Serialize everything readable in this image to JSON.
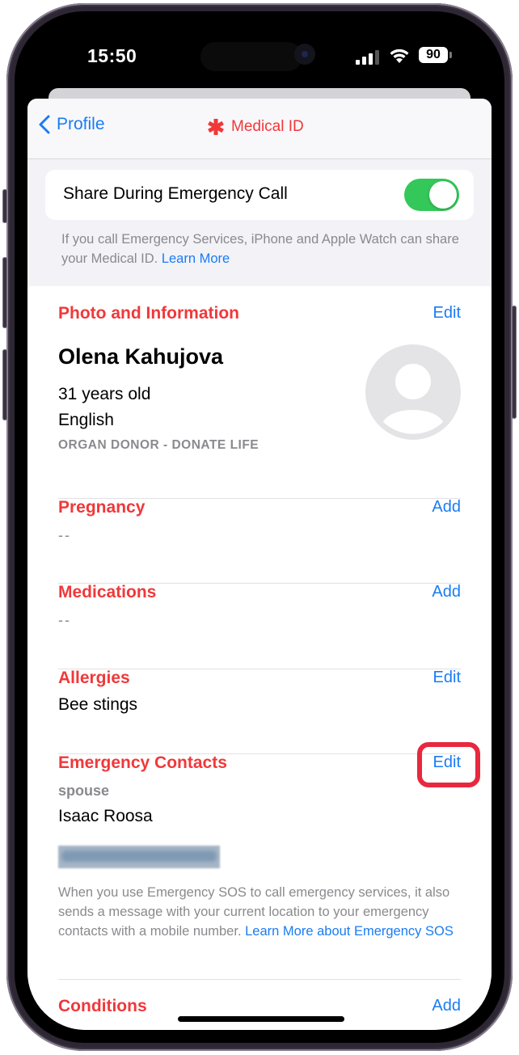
{
  "status_bar": {
    "time": "15:50",
    "battery": "90",
    "icons": [
      "cellular-signal-icon",
      "wifi-icon",
      "battery-icon"
    ]
  },
  "nav": {
    "back_label": "Profile",
    "title": "Medical ID",
    "title_icon": "medical-asterisk-icon"
  },
  "share_toggle": {
    "label": "Share During Emergency Call",
    "on": true,
    "footnote": "If you call Emergency Services, iPhone and Apple Watch can share your Medical ID.",
    "link": "Learn More"
  },
  "photo_info": {
    "title": "Photo and Information",
    "action": "Edit",
    "name": "Olena Kahujova",
    "age": "31 years old",
    "language": "English",
    "organ_donor": "ORGAN DONOR - DONATE LIFE"
  },
  "pregnancy": {
    "title": "Pregnancy",
    "action": "Add",
    "value": "--"
  },
  "medications": {
    "title": "Medications",
    "action": "Add",
    "value": "--"
  },
  "allergies": {
    "title": "Allergies",
    "action": "Edit",
    "value": "Bee stings"
  },
  "emergency_contacts": {
    "title": "Emergency Contacts",
    "action": "Edit",
    "relationship": "spouse",
    "contact_name": "Isaac Roosa",
    "note": "When you use Emergency SOS to call emergency services, it also sends a message with your current location to your emergency contacts with a mobile number.",
    "link": "Learn More about Emergency SOS"
  },
  "conditions": {
    "title": "Conditions",
    "action": "Add",
    "value": "--"
  },
  "colors": {
    "accent_blue": "#1a7cf3",
    "section_red": "#f0383a",
    "toggle_green": "#34c759",
    "highlight_red": "#e8283e"
  }
}
